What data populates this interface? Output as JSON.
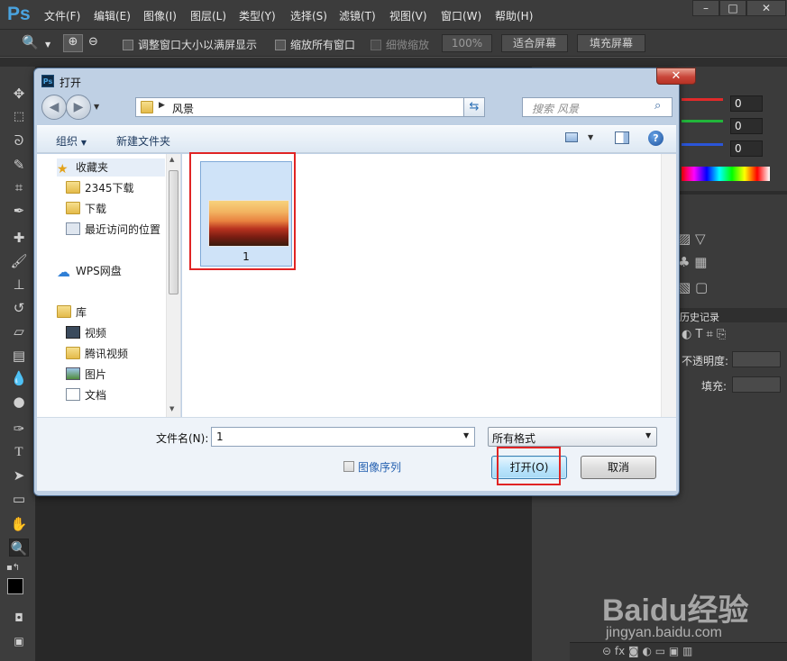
{
  "app": {
    "logo": "Ps",
    "menu": [
      "文件(F)",
      "编辑(E)",
      "图像(I)",
      "图层(L)",
      "类型(Y)",
      "选择(S)",
      "滤镜(T)",
      "视图(V)",
      "窗口(W)",
      "帮助(H)"
    ],
    "window_controls": {
      "minimize": "–",
      "maximize": "□",
      "close": "✕"
    }
  },
  "options_bar": {
    "resize_window": "调整窗口大小以满屏显示",
    "zoom_all": "缩放所有窗口",
    "scrubby_zoom": "细微缩放",
    "percent_button": "100%",
    "fit_screen_button": "适合屏幕",
    "fill_screen_button": "填充屏幕"
  },
  "right_panel": {
    "color_values": [
      "0",
      "0",
      "0"
    ],
    "history_tab": "历史记录",
    "opacity_label": "不透明度:",
    "fill_label": "填充:",
    "colors": {
      "red": "#e02a2a",
      "green": "#21b53a",
      "blue": "#2a55d8"
    }
  },
  "dialog": {
    "title": "打开",
    "title_icon": "Ps",
    "address_path": "风景",
    "search_placeholder": "搜索 风景",
    "organize": "组织",
    "new_folder": "新建文件夹",
    "nav_items": {
      "favorites": "收藏夹",
      "downloads_2345": "2345下载",
      "downloads": "下载",
      "recent": "最近访问的位置",
      "wps_cloud": "WPS网盘",
      "library": "库",
      "videos": "视频",
      "tencent_video": "腾讯视频",
      "pictures": "图片",
      "documents": "文档"
    },
    "file_item_name": "1",
    "filename_label": "文件名(N):",
    "filename_value": "1",
    "filetype_value": "所有格式",
    "image_sequence": "图像序列",
    "open_button": "打开(O)",
    "cancel_button": "取消"
  },
  "watermark": {
    "brand": "Baidu经验",
    "url": "jingyan.baidu.com"
  }
}
